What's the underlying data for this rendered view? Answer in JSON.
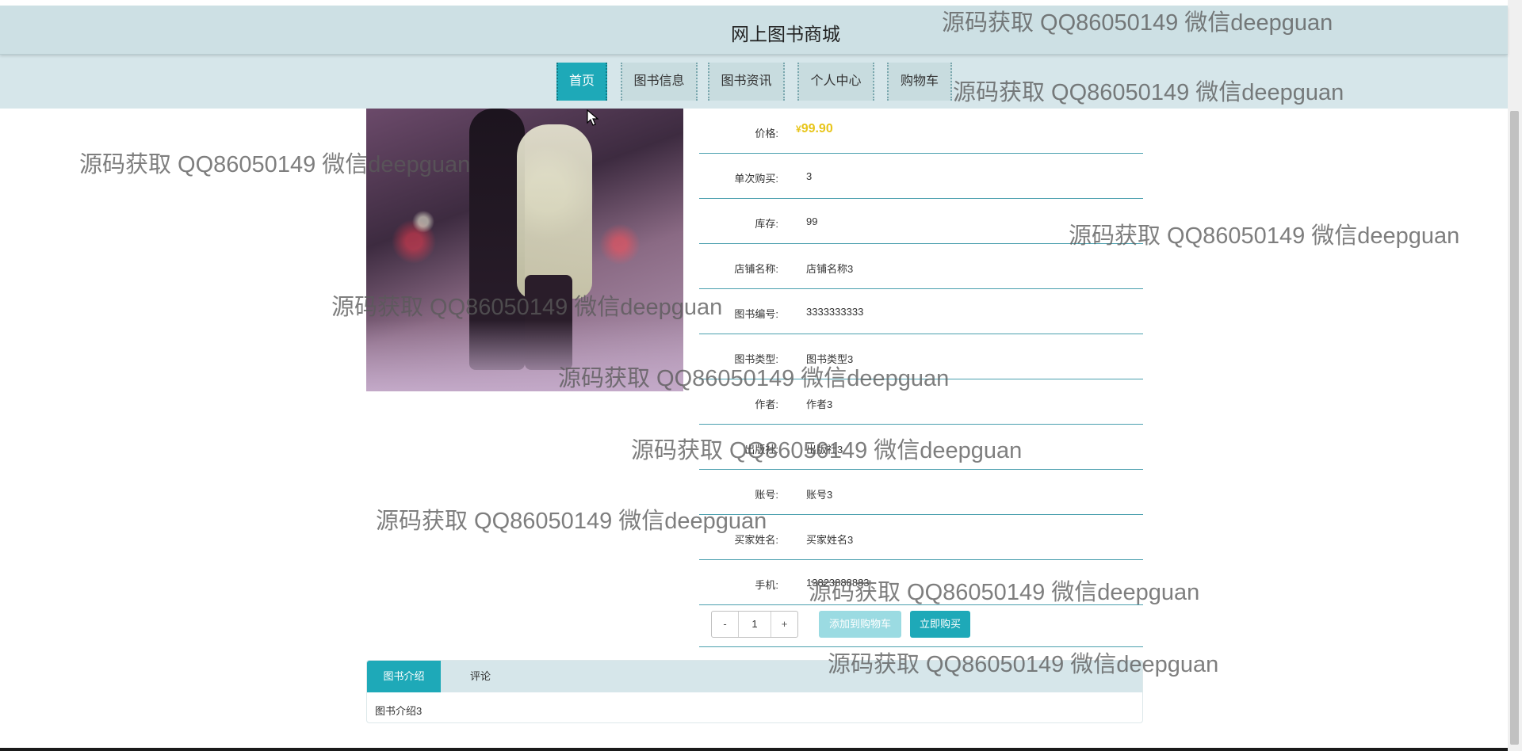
{
  "site": {
    "title": "网上图书商城"
  },
  "nav": {
    "items": [
      {
        "label": "首页",
        "active": true
      },
      {
        "label": "图书信息",
        "active": false
      },
      {
        "label": "图书资讯",
        "active": false
      },
      {
        "label": "个人中心",
        "active": false
      },
      {
        "label": "购物车",
        "active": false
      }
    ]
  },
  "product": {
    "price_label": "价格:",
    "price_symbol": "¥",
    "price_value": "99.90",
    "rows": [
      {
        "label": "单次购买:",
        "value": "3"
      },
      {
        "label": "库存:",
        "value": "99"
      },
      {
        "label": "店铺名称:",
        "value": "店铺名称3"
      },
      {
        "label": "图书编号:",
        "value": "3333333333"
      },
      {
        "label": "图书类型:",
        "value": "图书类型3"
      },
      {
        "label": "作者:",
        "value": "作者3"
      },
      {
        "label": "出版社:",
        "value": "出版社3"
      },
      {
        "label": "账号:",
        "value": "账号3"
      },
      {
        "label": "买家姓名:",
        "value": "买家姓名3"
      },
      {
        "label": "手机:",
        "value": "13823888883"
      }
    ]
  },
  "actions": {
    "minus": "-",
    "quantity": "1",
    "plus": "+",
    "add_to_cart": "添加到购物车",
    "buy_now": "立即购买"
  },
  "tabs": {
    "items": [
      {
        "label": "图书介绍",
        "active": true
      },
      {
        "label": "评论",
        "active": false
      }
    ],
    "content": "图书介绍3"
  },
  "watermark": {
    "text": "源码获取 QQ86050149 微信deepguan"
  },
  "colors": {
    "header_bg": "#cde0e4",
    "nav_bg": "#d6e6ea",
    "accent": "#1ea9b8",
    "accent_light": "#9bdbe2",
    "price": "#e8c51a",
    "row_divider": "#4a9fae"
  },
  "icons": {
    "cursor": "mouse-pointer-icon"
  }
}
